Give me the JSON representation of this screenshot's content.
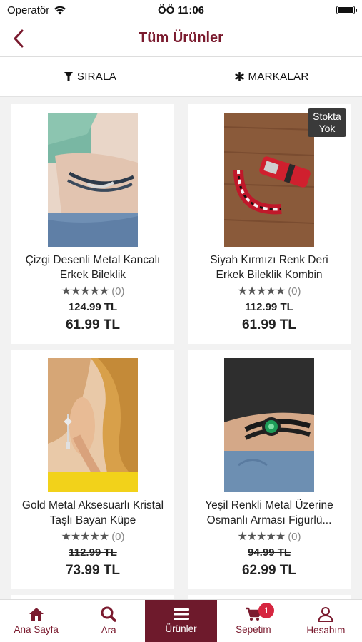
{
  "status_bar": {
    "carrier": "Operatör",
    "time": "ÖÖ 11:06"
  },
  "nav": {
    "title": "Tüm Ürünler"
  },
  "filters": {
    "sort_label": "SIRALA",
    "brands_label": "MARKALAR"
  },
  "products": [
    {
      "name": "Çizgi Desenli Metal Kancalı Erkek Bileklik",
      "rating_count": "(0)",
      "old_price": "124.99 TL",
      "price": "61.99 TL",
      "badge": ""
    },
    {
      "name": "Siyah Kırmızı Renk Deri Erkek Bileklik Kombin",
      "rating_count": "(0)",
      "old_price": "112.99 TL",
      "price": "61.99 TL",
      "badge": "Stokta Yok"
    },
    {
      "name": "Gold Metal Aksesuarlı Kristal Taşlı Bayan Küpe",
      "rating_count": "(0)",
      "old_price": "112.99 TL",
      "price": "73.99 TL",
      "badge": ""
    },
    {
      "name": "Yeşil Renkli Metal Üzerine Osmanlı Arması Figürlü...",
      "rating_count": "(0)",
      "old_price": "94.99 TL",
      "price": "62.99 TL",
      "badge": ""
    }
  ],
  "tabs": [
    {
      "label": "Ana Sayfa",
      "icon": "home-icon"
    },
    {
      "label": "Ara",
      "icon": "search-icon"
    },
    {
      "label": "Ürünler",
      "icon": "menu-icon"
    },
    {
      "label": "Sepetim",
      "icon": "cart-icon",
      "badge": "1"
    },
    {
      "label": "Hesabım",
      "icon": "user-icon"
    }
  ],
  "colors": {
    "brand": "#7a1a2e",
    "tab_active_bg": "#6e1a2c",
    "cart_badge": "#d6253f"
  }
}
